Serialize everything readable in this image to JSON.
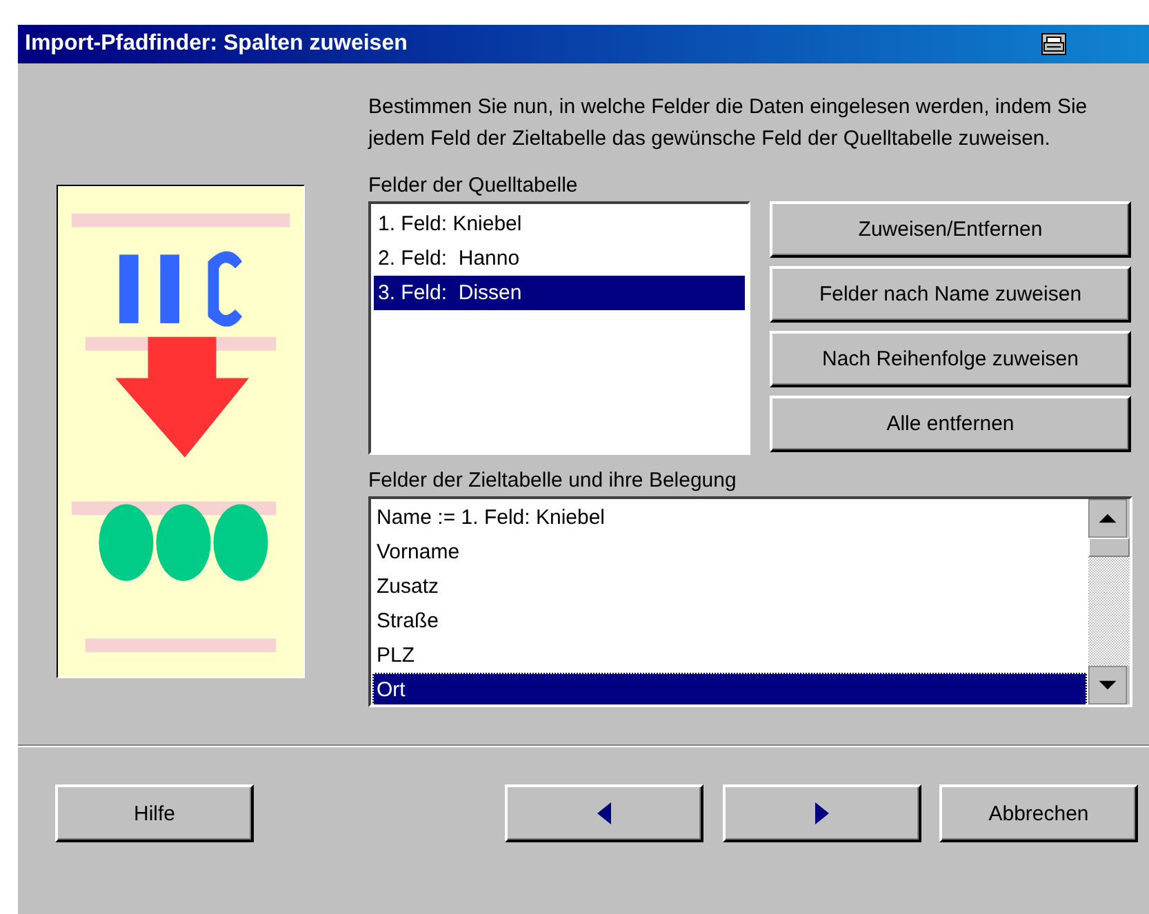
{
  "window": {
    "title": "Import-Pfadfinder: Spalten zuweisen"
  },
  "intro": "Bestimmen Sie nun, in welche Felder die Daten eingelesen werden, indem Sie jedem Feld der Zieltabelle das gewünsche Feld der Quelltabelle zuweisen.",
  "source_list": {
    "label": "Felder der Quelltabelle",
    "items": [
      {
        "text": "1. Feld: Kniebel",
        "selected": false
      },
      {
        "text": "2. Feld:  Hanno",
        "selected": false
      },
      {
        "text": "3. Feld:  Dissen",
        "selected": true
      }
    ]
  },
  "actions": [
    "Zuweisen/Entfernen",
    "Felder nach Name zuweisen",
    "Nach Reihenfolge zuweisen",
    "Alle entfernen"
  ],
  "target_list": {
    "label": "Felder der Zieltabelle und ihre Belegung",
    "items": [
      {
        "text": "Name := 1. Feld: Kniebel",
        "selected": false
      },
      {
        "text": "Vorname",
        "selected": false
      },
      {
        "text": "Zusatz",
        "selected": false
      },
      {
        "text": "Straße",
        "selected": false
      },
      {
        "text": "PLZ",
        "selected": false
      },
      {
        "text": "Ort",
        "selected": true
      }
    ]
  },
  "footer": [
    {
      "kind": "text",
      "label": "Hilfe"
    },
    {
      "kind": "back"
    },
    {
      "kind": "next"
    },
    {
      "kind": "text",
      "label": "Abbrechen"
    }
  ]
}
